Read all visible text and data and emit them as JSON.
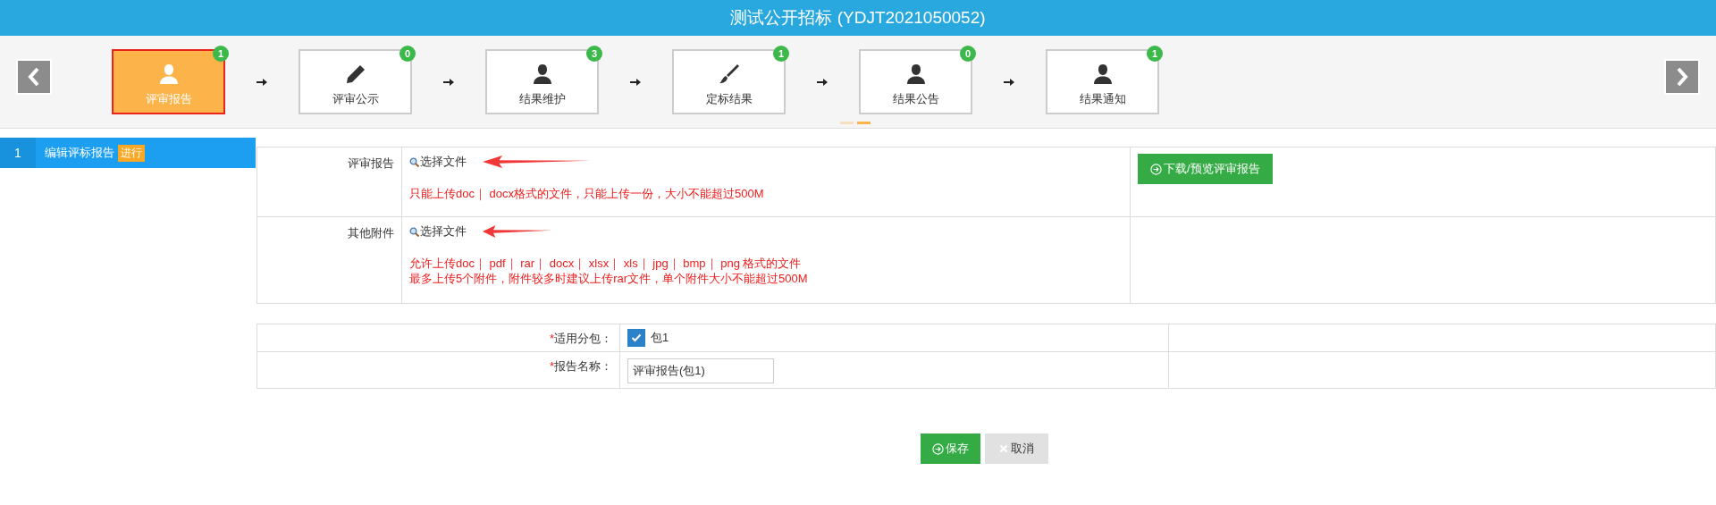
{
  "header": {
    "title": "测试公开招标 (YDJT2021050052)"
  },
  "steps": [
    {
      "label": "评审报告",
      "kind": "person",
      "count": "1",
      "selected": true
    },
    {
      "label": "评审公示",
      "kind": "pencil",
      "count": "0",
      "selected": false
    },
    {
      "label": "结果维护",
      "kind": "person",
      "count": "3",
      "selected": false
    },
    {
      "label": "定标结果",
      "kind": "brush",
      "count": "1",
      "selected": false
    },
    {
      "label": "结果公告",
      "kind": "person",
      "count": "0",
      "selected": false
    },
    {
      "label": "结果通知",
      "kind": "person",
      "count": "1",
      "selected": false
    }
  ],
  "pager": [
    {
      "selected": false
    },
    {
      "selected": true
    }
  ],
  "sidebar": {
    "items": [
      {
        "number": "1",
        "label": "编辑评标报告",
        "tag": "进行",
        "selected": true
      }
    ]
  },
  "upload_table": {
    "rows": [
      {
        "label": "评审报告",
        "choose": "选择文件",
        "hints": [
          "只能上传doc｜ docx格式的文件，只能上传一份，大小不能超过500M"
        ],
        "button": "下载/预览评审报告"
      },
      {
        "label": "其他附件",
        "choose": "选择文件",
        "hints": [
          "允许上传doc｜ pdf｜ rar｜ docx｜ xlsx｜ xls｜ jpg｜ bmp｜ png 格式的文件",
          "最多上传5个附件，附件较多时建议上传rar文件，单个附件大小不能超过500M"
        ]
      }
    ]
  },
  "form": {
    "package": {
      "required": "*",
      "label": "适用分包：",
      "option": "包1",
      "checked": true
    },
    "report_name": {
      "required": "*",
      "label": "报告名称：",
      "value": "评审报告(包1)"
    }
  },
  "buttons": {
    "save": "保存",
    "cancel": "取消"
  }
}
